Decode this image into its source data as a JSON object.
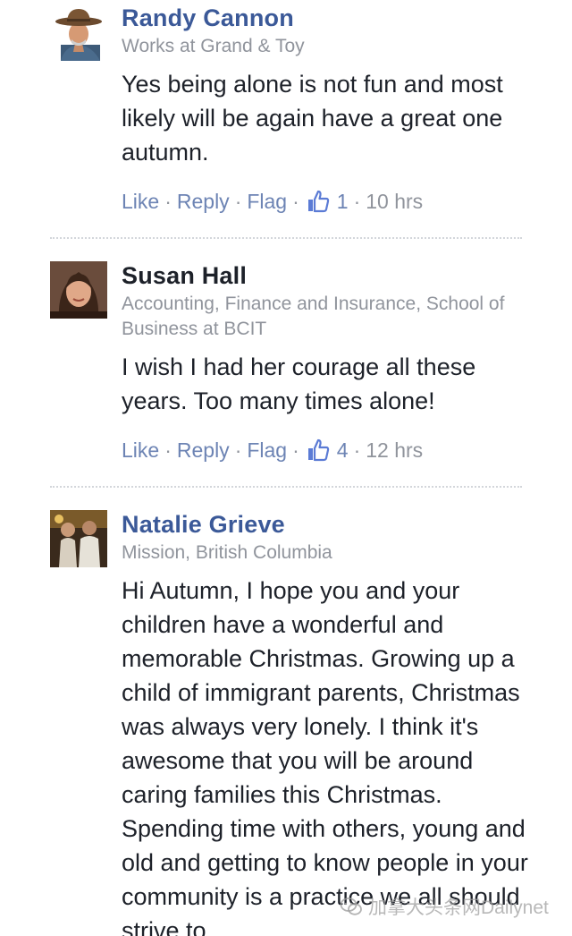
{
  "comments": [
    {
      "name": "Randy Cannon",
      "subtitle": "Works at Grand & Toy",
      "text": "Yes being alone is not fun and most likely will be again have a great one autumn.",
      "actions": {
        "like": "Like",
        "reply": "Reply",
        "flag": "Flag",
        "likes": "1",
        "time": "10 hrs"
      },
      "avatar_icon": "cowboy-hat-man-avatar"
    },
    {
      "name": "Susan Hall",
      "subtitle": "Accounting, Finance and Insurance, School of Business at BCIT",
      "text": "I wish I had her courage all these years. Too many times alone!",
      "actions": {
        "like": "Like",
        "reply": "Reply",
        "flag": "Flag",
        "likes": "4",
        "time": "12 hrs"
      },
      "avatar_icon": "woman-portrait-avatar"
    },
    {
      "name": "Natalie Grieve",
      "subtitle": "Mission, British Columbia",
      "text": "Hi Autumn, I hope you and your children have a wonderful and memorable Christmas. Growing up a child of immigrant parents, Christmas was always very lonely. I think it's awesome that you will be around caring families this Christmas. Spending time with others, young and old and getting to know people in your community is a practice we all should strive to",
      "actions": null,
      "avatar_icon": "couple-photo-avatar"
    }
  ],
  "watermark": {
    "text": "加拿大头条网Dailynet",
    "icon": "wechat-logo-icon"
  },
  "colors": {
    "name_link": "#3b5998",
    "name_dark": "#1d2129",
    "action_link": "#6d84b4",
    "muted": "#90949c",
    "divider": "#d3d6db"
  }
}
